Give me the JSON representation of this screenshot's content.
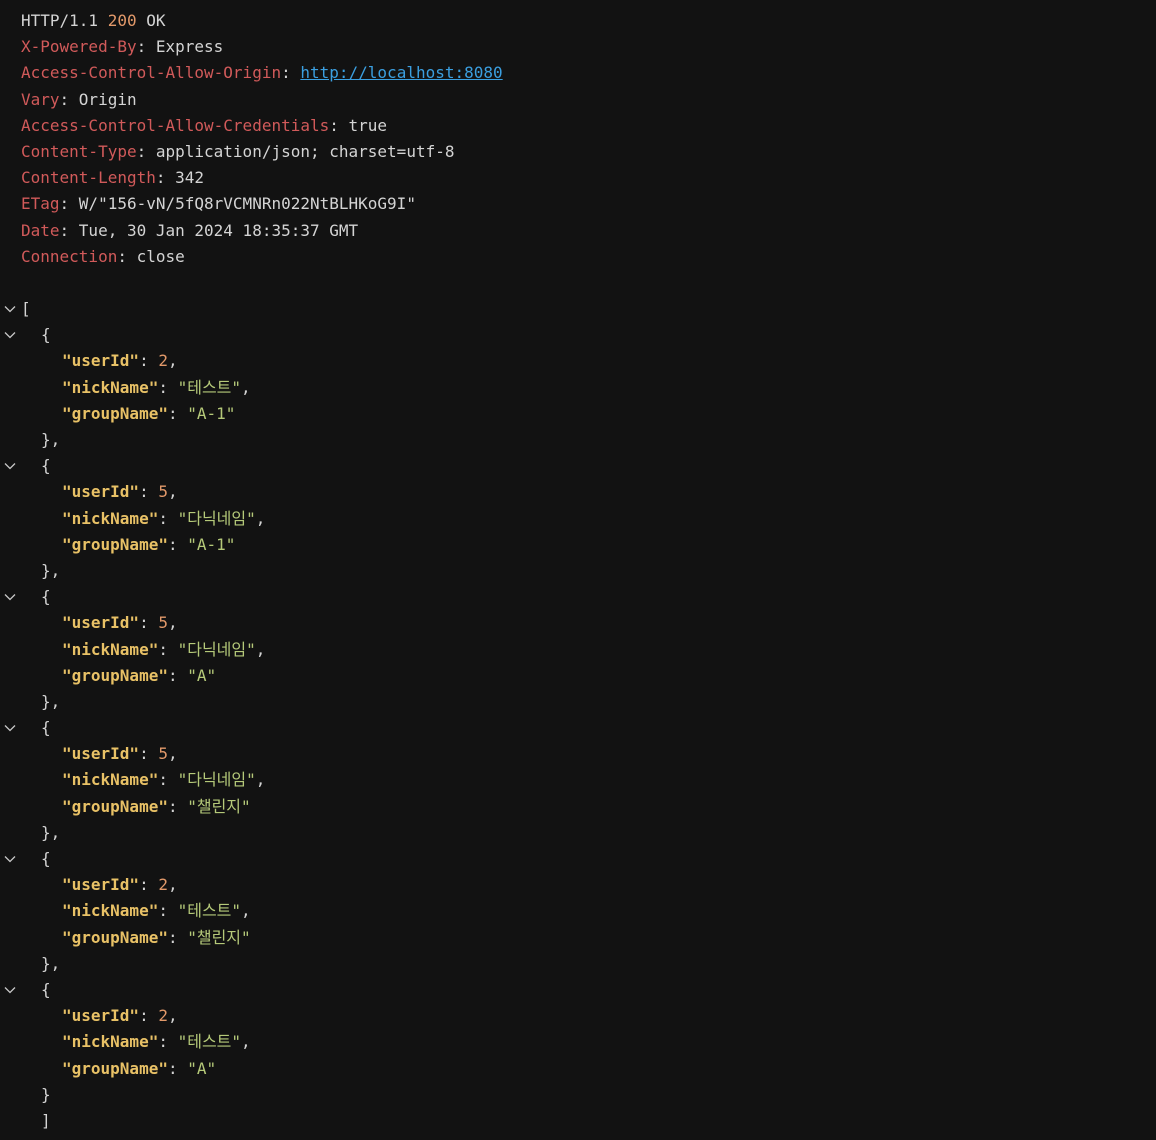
{
  "response": {
    "protocol": "HTTP/1.1",
    "status_code": "200",
    "status_text": "OK",
    "headers": [
      {
        "name": "X-Powered-By",
        "value": "Express"
      },
      {
        "name": "Access-Control-Allow-Origin",
        "value": "http://localhost:8080"
      },
      {
        "name": "Vary",
        "value": "Origin"
      },
      {
        "name": "Access-Control-Allow-Credentials",
        "value": "true"
      },
      {
        "name": "Content-Type",
        "value": "application/json; charset=utf-8"
      },
      {
        "name": "Content-Length",
        "value": "342"
      },
      {
        "name": "ETag",
        "value": "W/\"156-vN/5fQ8rVCMNRn022NtBLHKoG9I\""
      },
      {
        "name": "Date",
        "value": "Tue, 30 Jan 2024 18:35:37 GMT"
      },
      {
        "name": "Connection",
        "value": "close"
      }
    ]
  },
  "body": {
    "open_bracket": "[",
    "close_bracket": "]",
    "items": [
      {
        "userId": "2",
        "nickName": "\"테스트\"",
        "groupName": "\"A-1\""
      },
      {
        "userId": "5",
        "nickName": "\"다닉네임\"",
        "groupName": "\"A-1\""
      },
      {
        "userId": "5",
        "nickName": "\"다닉네임\"",
        "groupName": "\"A\""
      },
      {
        "userId": "5",
        "nickName": "\"다닉네임\"",
        "groupName": "\"챌린지\""
      },
      {
        "userId": "2",
        "nickName": "\"테스트\"",
        "groupName": "\"챌린지\""
      },
      {
        "userId": "2",
        "nickName": "\"테스트\"",
        "groupName": "\"A\""
      }
    ],
    "keys": {
      "userId": "\"userId\"",
      "nickName": "\"nickName\"",
      "groupName": "\"groupName\""
    }
  },
  "icons": {
    "fold": "chevron-down-icon"
  },
  "colors": {
    "background": "#121212",
    "text": "#d4d4d4",
    "header_name": "#d15a5a",
    "status_code": "#e2996a",
    "link": "#3b9fe0",
    "json_key": "#e8c166",
    "json_number": "#e2996a",
    "json_string": "#b5c979"
  }
}
